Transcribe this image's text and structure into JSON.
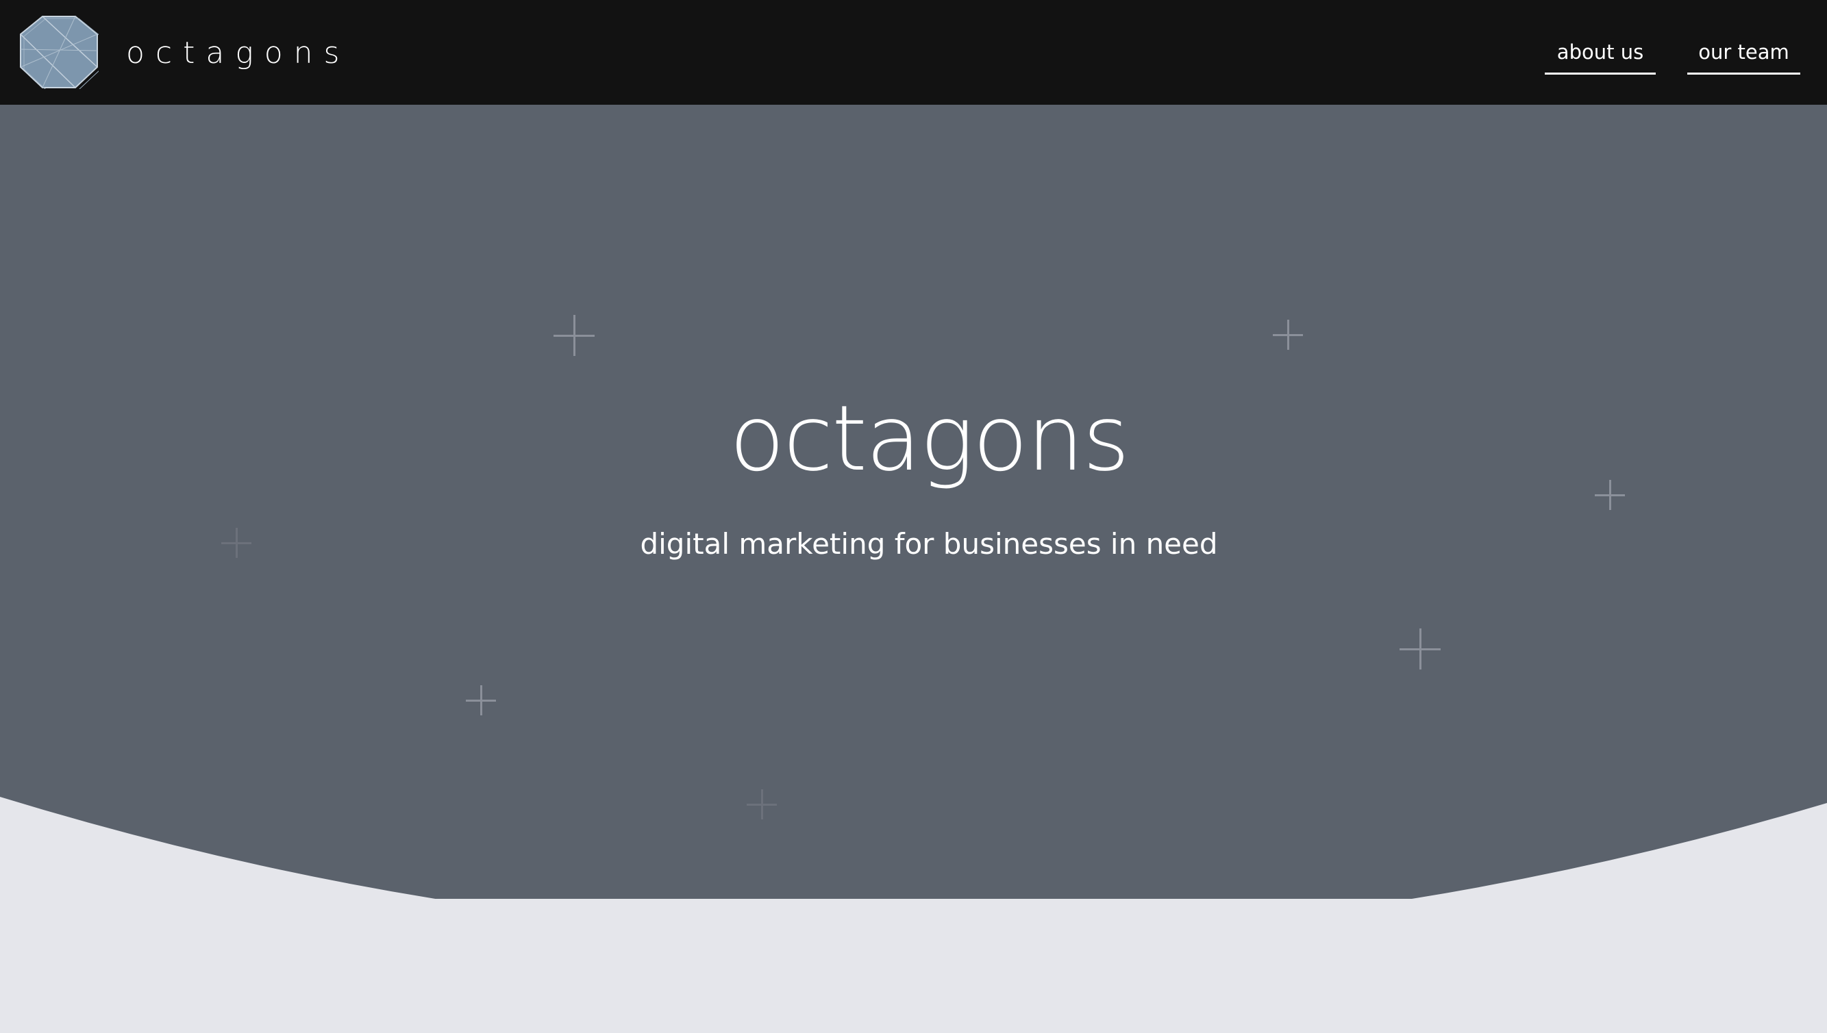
{
  "header": {
    "brand": "octagons",
    "logo_icon": "octagon-logo-icon",
    "nav": [
      {
        "label": "about us"
      },
      {
        "label": "our team"
      }
    ]
  },
  "hero": {
    "title": "octagons",
    "subtitle": "digital marketing for businesses in need",
    "decor_icon": "plus-icon"
  },
  "colors": {
    "navbar_bg": "#121212",
    "hero_bg": "#5b626c",
    "page_bg": "#e5e6eb",
    "logo_fill": "#7d96ad",
    "text": "#ffffff"
  }
}
